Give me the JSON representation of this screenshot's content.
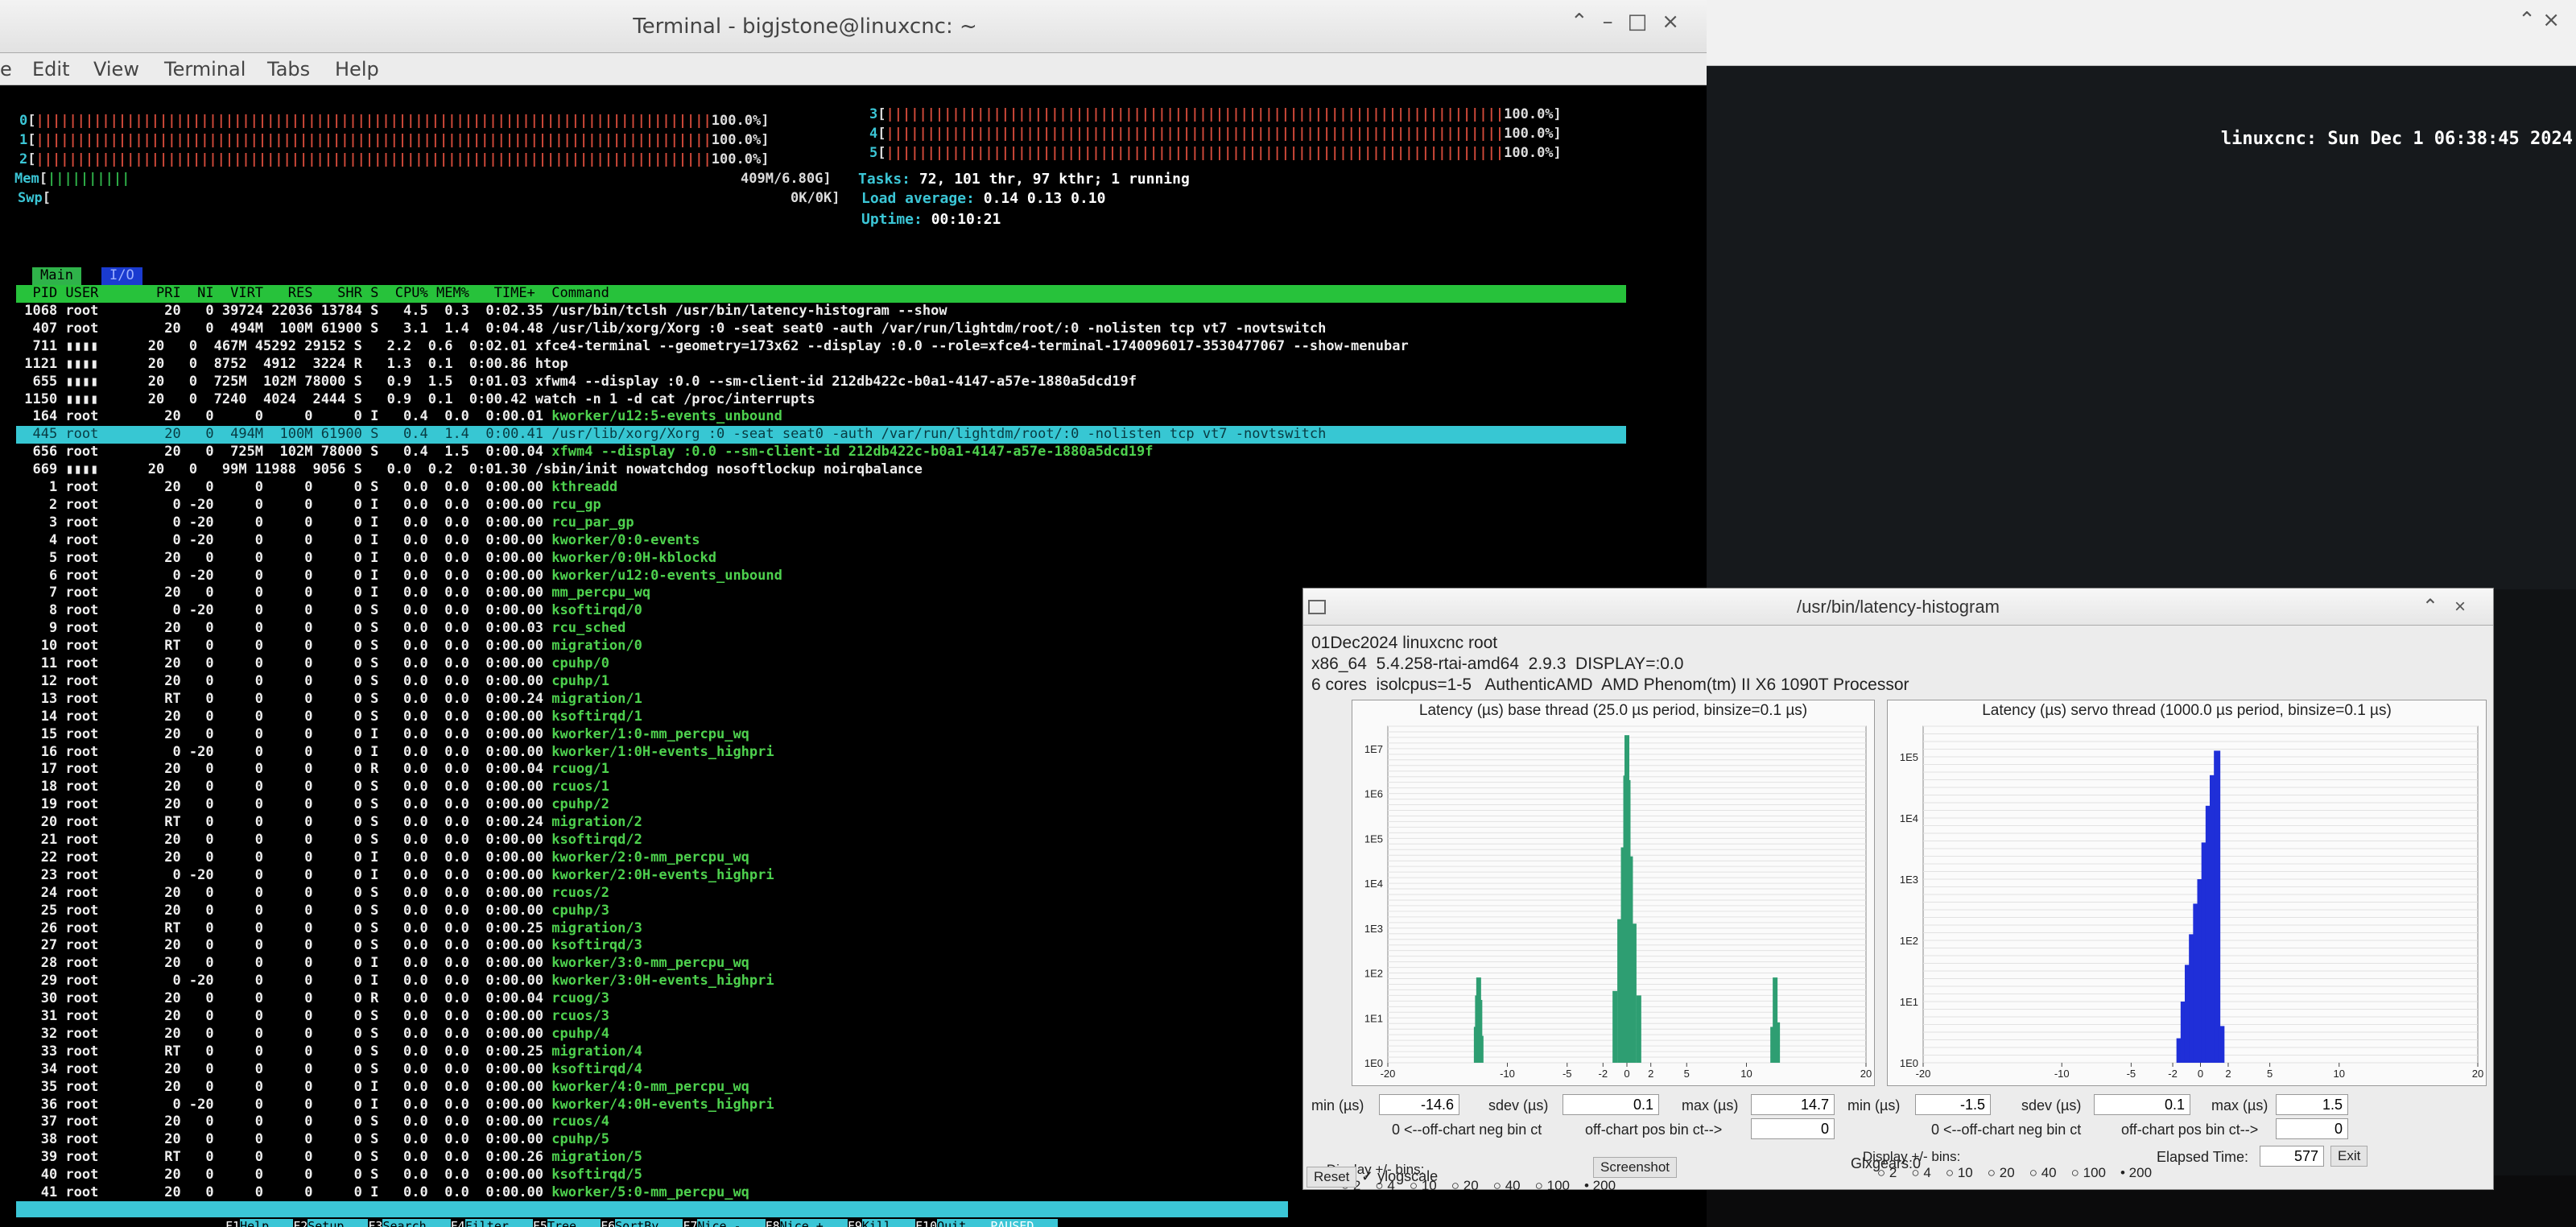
{
  "terminal": {
    "title": "Terminal - bigjstone@linuxcnc: ~",
    "menu": [
      "e",
      "Edit",
      "View",
      "Terminal",
      "Tabs",
      "Help"
    ]
  },
  "desktop": {
    "clock": "linuxcnc: Sun Dec  1 06:38:45 2024"
  },
  "htop": {
    "cpu_meters": [
      {
        "id": "0",
        "value": "100.0%"
      },
      {
        "id": "1",
        "value": "100.0%"
      },
      {
        "id": "2",
        "value": "100.0%"
      },
      {
        "id": "3",
        "value": "100.0%"
      },
      {
        "id": "4",
        "value": "100.0%"
      },
      {
        "id": "5",
        "value": "100.0%"
      }
    ],
    "mem_label": "Mem",
    "mem_value": "409M/6.80G",
    "swp_label": "Swp",
    "swp_value": "0K/0K",
    "tasks_label": "Tasks:",
    "tasks_value": "72, 101 thr, 97 kthr; 1 running",
    "load_label": "Load average:",
    "load_value": "0.14 0.13 0.10",
    "uptime_label": "Uptime:",
    "uptime_value": "00:10:21",
    "tabs": [
      "Main",
      "I/O"
    ],
    "header": "  PID USER       PRI  NI  VIRT   RES   SHR S  CPU% MEM%   TIME+  Command",
    "rows": [
      {
        "line": " 1068 root        20   0 39724 22036 13784 S   4.5  0.3  0:02.35 ",
        "cmd": "/usr/bin/tclsh /usr/bin/latency-histogram --show"
      },
      {
        "line": "  407 root        20   0  494M  100M 61900 S   3.1  1.4  0:04.48 ",
        "cmd": "/usr/lib/xorg/Xorg :0 -seat seat0 -auth /var/run/lightdm/root/:0 -nolisten tcp vt7 -novtswitch"
      },
      {
        "line": "  711 ▮▮▮▮      20   0  467M 45292 29152 S   2.2  0.6  0:02.01 ",
        "cmd": "xfce4-terminal --geometry=173x62 --display :0.0 --role=xfce4-terminal-1740096017-3530477067 --show-menubar"
      },
      {
        "line": " 1121 ▮▮▮▮      20   0  8752  4912  3224 R   1.3  0.1  0:00.86 ",
        "cmd": "htop"
      },
      {
        "line": "  655 ▮▮▮▮      20   0  725M  102M 78000 S   0.9  1.5  0:01.03 ",
        "cmd": "xfwm4 --display :0.0 --sm-client-id 212db422c-b0a1-4147-a57e-1880a5dcd19f"
      },
      {
        "line": " 1150 ▮▮▮▮      20   0  7240  4024  2444 S   0.9  0.1  0:00.42 ",
        "cmd": "watch -n 1 -d cat /proc/interrupts"
      },
      {
        "line": "  164 root        20   0     0     0     0 I   0.4  0.0  0:00.01 ",
        "cmd": "kworker/u12:5-events_unbound"
      },
      {
        "line": "  445 root        20   0  494M  100M 61900 S   0.4  1.4  0:00.41 ",
        "cmd": "/usr/lib/xorg/Xorg :0 -seat seat0 -auth /var/run/lightdm/root/:0 -nolisten tcp vt7 -novtswitch",
        "selected": true
      },
      {
        "line": "  656 root        20   0  725M  102M 78000 S   0.4  1.5  0:00.04 ",
        "cmd": "xfwm4 --display :0.0 --sm-client-id 212db422c-b0a1-4147-a57e-1880a5dcd19f"
      },
      {
        "line": "  669 ▮▮▮▮      20   0   99M 11988  9056 S   0.0  0.2  0:01.30 ",
        "cmd": "/sbin/init nowatchdog nosoftlockup noirqbalance"
      },
      {
        "line": "    1 root        20   0     0     0     0 S   0.0  0.0  0:00.00 ",
        "cmd": "kthreadd"
      },
      {
        "line": "    2 root         0 -20     0     0     0 I   0.0  0.0  0:00.00 ",
        "cmd": "rcu_gp"
      },
      {
        "line": "    3 root         0 -20     0     0     0 I   0.0  0.0  0:00.00 ",
        "cmd": "rcu_par_gp"
      },
      {
        "line": "    4 root         0 -20     0     0     0 I   0.0  0.0  0:00.00 ",
        "cmd": "kworker/0:0-events"
      },
      {
        "line": "    5 root        20   0     0     0     0 I   0.0  0.0  0:00.00 ",
        "cmd": "kworker/0:0H-kblockd"
      },
      {
        "line": "    6 root         0 -20     0     0     0 I   0.0  0.0  0:00.00 ",
        "cmd": "kworker/u12:0-events_unbound"
      },
      {
        "line": "    7 root        20   0     0     0     0 I   0.0  0.0  0:00.00 ",
        "cmd": "mm_percpu_wq"
      },
      {
        "line": "    8 root         0 -20     0     0     0 S   0.0  0.0  0:00.00 ",
        "cmd": "ksoftirqd/0"
      },
      {
        "line": "    9 root        20   0     0     0     0 S   0.0  0.0  0:00.03 ",
        "cmd": "rcu_sched"
      },
      {
        "line": "   10 root        RT   0     0     0     0 S   0.0  0.0  0:00.00 ",
        "cmd": "migration/0"
      },
      {
        "line": "   11 root        20   0     0     0     0 S   0.0  0.0  0:00.00 ",
        "cmd": "cpuhp/0"
      },
      {
        "line": "   12 root        20   0     0     0     0 S   0.0  0.0  0:00.00 ",
        "cmd": "cpuhp/1"
      },
      {
        "line": "   13 root        RT   0     0     0     0 S   0.0  0.0  0:00.24 ",
        "cmd": "migration/1"
      },
      {
        "line": "   14 root        20   0     0     0     0 S   0.0  0.0  0:00.00 ",
        "cmd": "ksoftirqd/1"
      },
      {
        "line": "   15 root        20   0     0     0     0 I   0.0  0.0  0:00.00 ",
        "cmd": "kworker/1:0-mm_percpu_wq"
      },
      {
        "line": "   16 root         0 -20     0     0     0 I   0.0  0.0  0:00.00 ",
        "cmd": "kworker/1:0H-events_highpri"
      },
      {
        "line": "   17 root        20   0     0     0     0 R   0.0  0.0  0:00.04 ",
        "cmd": "rcuog/1"
      },
      {
        "line": "   18 root        20   0     0     0     0 S   0.0  0.0  0:00.00 ",
        "cmd": "rcuos/1"
      },
      {
        "line": "   19 root        20   0     0     0     0 S   0.0  0.0  0:00.00 ",
        "cmd": "cpuhp/2"
      },
      {
        "line": "   20 root        RT   0     0     0     0 S   0.0  0.0  0:00.24 ",
        "cmd": "migration/2"
      },
      {
        "line": "   21 root        20   0     0     0     0 S   0.0  0.0  0:00.00 ",
        "cmd": "ksoftirqd/2"
      },
      {
        "line": "   22 root        20   0     0     0     0 I   0.0  0.0  0:00.00 ",
        "cmd": "kworker/2:0-mm_percpu_wq"
      },
      {
        "line": "   23 root         0 -20     0     0     0 I   0.0  0.0  0:00.00 ",
        "cmd": "kworker/2:0H-events_highpri"
      },
      {
        "line": "   24 root        20   0     0     0     0 S   0.0  0.0  0:00.00 ",
        "cmd": "rcuos/2"
      },
      {
        "line": "   25 root        20   0     0     0     0 S   0.0  0.0  0:00.00 ",
        "cmd": "cpuhp/3"
      },
      {
        "line": "   26 root        RT   0     0     0     0 S   0.0  0.0  0:00.25 ",
        "cmd": "migration/3"
      },
      {
        "line": "   27 root        20   0     0     0     0 S   0.0  0.0  0:00.00 ",
        "cmd": "ksoftirqd/3"
      },
      {
        "line": "   28 root        20   0     0     0     0 I   0.0  0.0  0:00.00 ",
        "cmd": "kworker/3:0-mm_percpu_wq"
      },
      {
        "line": "   29 root         0 -20     0     0     0 I   0.0  0.0  0:00.00 ",
        "cmd": "kworker/3:0H-events_highpri"
      },
      {
        "line": "   30 root        20   0     0     0     0 R   0.0  0.0  0:00.04 ",
        "cmd": "rcuog/3"
      },
      {
        "line": "   31 root        20   0     0     0     0 S   0.0  0.0  0:00.00 ",
        "cmd": "rcuos/3"
      },
      {
        "line": "   32 root        20   0     0     0     0 S   0.0  0.0  0:00.00 ",
        "cmd": "cpuhp/4"
      },
      {
        "line": "   33 root        RT   0     0     0     0 S   0.0  0.0  0:00.25 ",
        "cmd": "migration/4"
      },
      {
        "line": "   34 root        20   0     0     0     0 S   0.0  0.0  0:00.00 ",
        "cmd": "ksoftirqd/4"
      },
      {
        "line": "   35 root        20   0     0     0     0 I   0.0  0.0  0:00.00 ",
        "cmd": "kworker/4:0-mm_percpu_wq"
      },
      {
        "line": "   36 root         0 -20     0     0     0 I   0.0  0.0  0:00.00 ",
        "cmd": "kworker/4:0H-events_highpri"
      },
      {
        "line": "   37 root        20   0     0     0     0 S   0.0  0.0  0:00.00 ",
        "cmd": "rcuos/4"
      },
      {
        "line": "   38 root        20   0     0     0     0 S   0.0  0.0  0:00.00 ",
        "cmd": "cpuhp/5"
      },
      {
        "line": "   39 root        RT   0     0     0     0 S   0.0  0.0  0:00.26 ",
        "cmd": "migration/5"
      },
      {
        "line": "   40 root        20   0     0     0     0 S   0.0  0.0  0:00.00 ",
        "cmd": "ksoftirqd/5"
      },
      {
        "line": "   41 root        20   0     0     0     0 I   0.0  0.0  0:00.00 ",
        "cmd": "kworker/5:0-mm_percpu_wq"
      }
    ],
    "fkeys": [
      {
        "k": "F1",
        "l": "Help"
      },
      {
        "k": "F2",
        "l": "Setup"
      },
      {
        "k": "F3",
        "l": "Search"
      },
      {
        "k": "F4",
        "l": "Filter"
      },
      {
        "k": "F5",
        "l": "Tree"
      },
      {
        "k": "F6",
        "l": "SortBy"
      },
      {
        "k": "F7",
        "l": "Nice -"
      },
      {
        "k": "F8",
        "l": "Nice +"
      },
      {
        "k": "F9",
        "l": "Kill"
      },
      {
        "k": "F10",
        "l": "Quit"
      }
    ],
    "paused": "PAUSED"
  },
  "histogram": {
    "title": "/usr/bin/latency-histogram",
    "info1": "01Dec2024 linuxcnc root",
    "info2": "x86_64  5.4.258-rtai-amd64  2.9.3  DISPLAY=:0.0",
    "info3": "6 cores  isolcpus=1-5   AuthenticAMD  AMD Phenom(tm) II X6 1090T Processor",
    "base": {
      "title": "Latency (µs) base thread (25.0 µs period, binsize=0.1 µs)",
      "min_label": "min (µs)",
      "min": "-14.6",
      "sdev_label": "sdev (µs)",
      "sdev": "0.1",
      "max_label": "max (µs)",
      "max": "14.7",
      "neg_label": "0 <--off-chart neg bin ct",
      "pos_label": "off-chart pos bin ct-->",
      "pos": "0"
    },
    "servo": {
      "title": "Latency (µs) servo thread (1000.0 µs period, binsize=0.1 µs)",
      "min_label": "min (µs)",
      "min": "-1.5",
      "sdev_label": "sdev (µs)",
      "sdev": "0.1",
      "max_label": "max (µs)",
      "max": "1.5",
      "neg_label": "0 <--off-chart neg bin ct",
      "pos_label": "off-chart pos bin ct-->",
      "pos": "0"
    },
    "bins_label": "Display +/- bins:",
    "bins_options": [
      "2",
      "4",
      "10",
      "20",
      "40",
      "100",
      "200"
    ],
    "bins_selected": "200",
    "reset_label": "Reset",
    "ylogscale_label": "ylogscale",
    "screenshot_label": "Screenshot",
    "glxgears_label": "Glxgears:0",
    "elapsed_label": "Elapsed Time:",
    "elapsed_value": "577",
    "exit_label": "Exit",
    "colors": {
      "base": "#2e9e72",
      "servo": "#1f2fd8"
    }
  },
  "chart_data": [
    {
      "type": "bar",
      "title": "Latency (µs) base thread (25.0 µs period, binsize=0.1 µs)",
      "y_scale": "log",
      "ytick_labels": [
        "1E0",
        "1E1",
        "1E2",
        "1E3",
        "1E4",
        "1E5",
        "1E6",
        "1E7"
      ],
      "xtick_labels": [
        "-20",
        "-10",
        "-5",
        "-2",
        "0",
        "2",
        "5",
        "10",
        "20"
      ],
      "xlim": [
        -20,
        20
      ],
      "ylim_log10": [
        0,
        7.5
      ],
      "color": "#2e9e72",
      "x": [
        -12.6,
        -12.5,
        -12.4,
        -12.3,
        -12.2,
        -1.0,
        -0.6,
        -0.3,
        -0.1,
        0,
        0.1,
        0.3,
        0.6,
        1.0,
        12.2,
        12.4,
        12.6
      ],
      "values_log10": [
        0.8,
        1.5,
        1.9,
        1.4,
        0.6,
        1.6,
        3.2,
        4.8,
        6.4,
        7.3,
        6.3,
        4.6,
        3.1,
        1.5,
        0.8,
        1.9,
        0.9
      ]
    },
    {
      "type": "bar",
      "title": "Latency (µs) servo thread (1000.0 µs period, binsize=0.1 µs)",
      "y_scale": "log",
      "ytick_labels": [
        "1E0",
        "1E1",
        "1E2",
        "1E3",
        "1E4",
        "1E5"
      ],
      "xtick_labels": [
        "-20",
        "-10",
        "-5",
        "-2",
        "0",
        "2",
        "5",
        "10",
        "20"
      ],
      "xlim": [
        -20,
        20
      ],
      "ylim_log10": [
        0,
        5.5
      ],
      "color": "#1f2fd8",
      "x": [
        -1.5,
        -1.2,
        -0.9,
        -0.6,
        -0.3,
        0,
        0.3,
        0.6,
        0.9,
        1.2,
        1.5
      ],
      "values_log10": [
        0.4,
        1.0,
        1.6,
        2.1,
        2.6,
        3.0,
        3.6,
        4.2,
        4.7,
        5.1,
        0.6
      ]
    }
  ]
}
